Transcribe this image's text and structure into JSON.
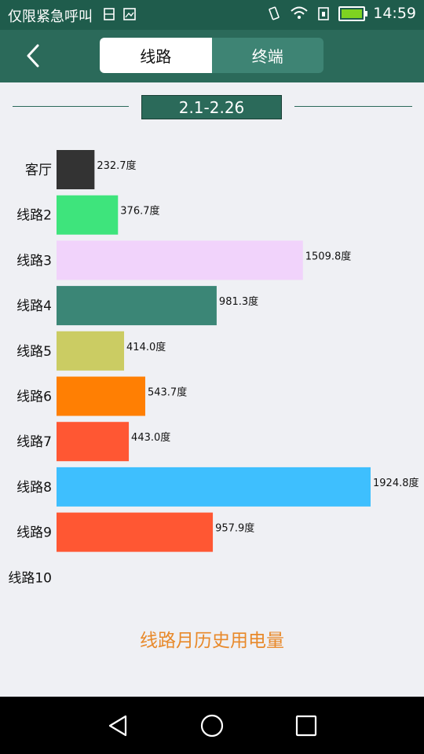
{
  "status_bar": {
    "notification": "仅限紧急呼叫",
    "time": "14:59"
  },
  "header": {
    "tabs": [
      {
        "label": "线路",
        "active": true
      },
      {
        "label": "终端",
        "active": false
      }
    ]
  },
  "date_range": "2.1-2.26",
  "colors": {
    "accent": "#2b6a5a",
    "title": "#e8892a"
  },
  "chart_data": {
    "type": "bar",
    "orientation": "horizontal",
    "title": "线路月历史用电量",
    "unit": "度",
    "categories": [
      "客厅",
      "线路2",
      "线路3",
      "线路4",
      "线路5",
      "线路6",
      "线路7",
      "线路8",
      "线路9",
      "线路10"
    ],
    "values": [
      232.7,
      376.7,
      1509.8,
      981.3,
      414.0,
      543.7,
      443.0,
      1924.8,
      957.9,
      null
    ],
    "value_labels": [
      "232.7度",
      "376.7度",
      "1509.8度",
      "981.3度",
      "414.0度",
      "543.7度",
      "443.0度",
      "1924.8度",
      "957.9度",
      ""
    ],
    "colors": [
      "#333333",
      "#3ee47c",
      "#f1d3fb",
      "#3b8676",
      "#cbcc63",
      "#ff7f03",
      "#ff5733",
      "#3ebffe",
      "#ff5733",
      null
    ],
    "xlim": [
      0,
      1924.8
    ],
    "grid": false,
    "legend": false
  }
}
